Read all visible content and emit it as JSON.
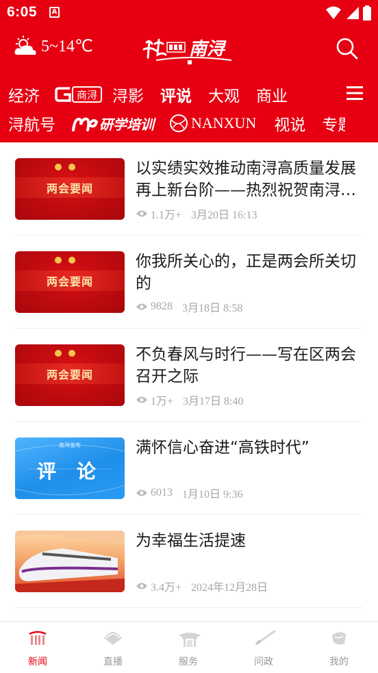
{
  "status_bar": {
    "time": "6:05",
    "app_badge": "A"
  },
  "header": {
    "weather_text": "5~14℃",
    "weather_icon": "sun-cloud-icon",
    "logo_text": "南浔",
    "search_icon": "search-icon",
    "menu_icon": "menu-icon"
  },
  "channels": {
    "row1": [
      "经济",
      "G商浔",
      "浔影",
      "评说",
      "大观",
      "商业"
    ],
    "row2": [
      "浔航号",
      "研学培训",
      "NANXUN",
      "视说",
      "专题"
    ],
    "active": "评说"
  },
  "news": [
    {
      "title": "以实绩实效推动南浔高质量发展再上新台阶——热烈祝贺南浔区两会胜利召开",
      "views": "1.1万+",
      "date": "3月20日  16:13",
      "thumb_label": "两会要闻"
    },
    {
      "title": "你我所关心的，正是两会所关切的",
      "views": "9828",
      "date": "3月18日  8:58",
      "thumb_label": "两会要闻"
    },
    {
      "title": "不负春风与时行——写在区两会召开之际",
      "views": "1万+",
      "date": "3月17日  8:40",
      "thumb_label": "两会要闻"
    },
    {
      "title": "满怀信心奋进“高铁时代”",
      "views": "6013",
      "date": "1月10日  9:36",
      "thumb_label": "评  论",
      "thumb_small": "南浔发布"
    },
    {
      "title": "为幸福生活提速",
      "views": "3.4万+",
      "date": "2024年12月28日",
      "thumb_label": ""
    }
  ],
  "tabbar": [
    {
      "label": "新闻",
      "icon": "news-gate-icon",
      "active": true
    },
    {
      "label": "直播",
      "icon": "live-fan-icon",
      "active": false
    },
    {
      "label": "服务",
      "icon": "service-pavilion-icon",
      "active": false
    },
    {
      "label": "问政",
      "icon": "brush-icon",
      "active": false
    },
    {
      "label": "我的",
      "icon": "profile-shell-icon",
      "active": false
    }
  ],
  "colors": {
    "brand_red": "#e60012",
    "text": "#1a1a1a",
    "meta_gray": "#a6a6a6",
    "tab_gray": "#999999"
  }
}
